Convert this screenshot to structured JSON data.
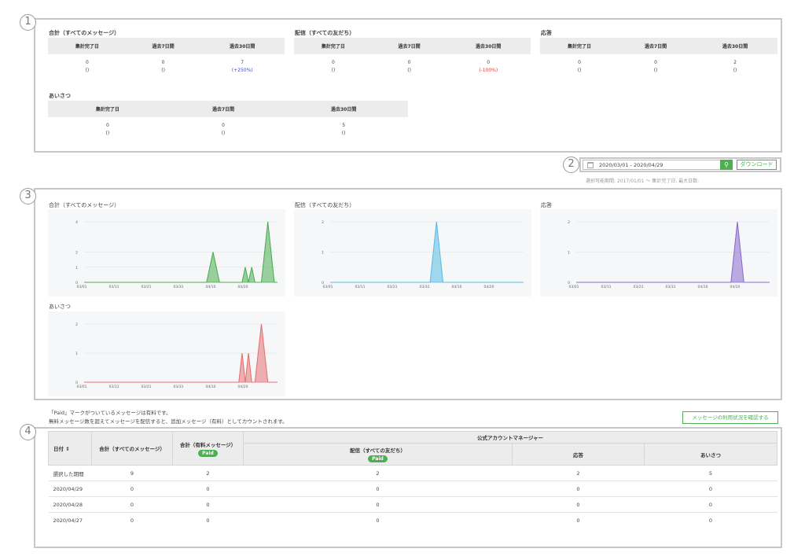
{
  "markers": {
    "m1": "1",
    "m2": "2",
    "m3": "3",
    "m4": "4"
  },
  "summary": {
    "headers": [
      "集計完了日",
      "過去7日間",
      "過去30日間"
    ],
    "blocks": [
      {
        "title": "合計（すべてのメッセージ）",
        "values": [
          "0",
          "0",
          "7"
        ],
        "changes": [
          "()",
          "()",
          "(+250%)"
        ]
      },
      {
        "title": "配信（すべての友だち）",
        "values": [
          "0",
          "0",
          "0"
        ],
        "changes": [
          "()",
          "()",
          "(-100%)"
        ]
      },
      {
        "title": "応答",
        "values": [
          "0",
          "0",
          "2"
        ],
        "changes": [
          "()",
          "()",
          "()"
        ]
      },
      {
        "title": "あいさつ",
        "values": [
          "0",
          "0",
          "5"
        ],
        "changes": [
          "()",
          "()",
          "()"
        ]
      }
    ]
  },
  "date_filter": {
    "range": "2020/03/01 - 2020/04/29",
    "download_label": "ダウンロード",
    "note": "選択可能期間: 2017/01/01 〜 集計完了日, 最大日数:"
  },
  "colors": {
    "green": "#4caf50",
    "blue": "#5bbde4",
    "purple": "#8b6ccf",
    "red": "#e57373"
  },
  "chart_data": [
    {
      "type": "area",
      "title": "合計（すべてのメッセージ）",
      "x": [
        "03/01",
        "03/11",
        "03/21",
        "03/31",
        "04/10",
        "04/20"
      ],
      "ylim": [
        0,
        4
      ],
      "yticks": [
        0,
        1,
        2,
        4
      ],
      "color": "#4caf50",
      "points": [
        [
          0,
          0
        ],
        [
          38,
          0
        ],
        [
          40,
          2
        ],
        [
          42,
          0
        ],
        [
          49,
          0
        ],
        [
          50,
          1
        ],
        [
          51,
          0
        ],
        [
          52,
          1
        ],
        [
          53,
          0
        ],
        [
          55,
          0
        ],
        [
          57,
          4
        ],
        [
          59,
          0
        ],
        [
          60,
          0
        ]
      ]
    },
    {
      "type": "area",
      "title": "配信（すべての友だち）",
      "x": [
        "03/01",
        "03/11",
        "03/21",
        "03/31",
        "04/10",
        "04/20"
      ],
      "ylim": [
        0,
        2
      ],
      "yticks": [
        0,
        1,
        2
      ],
      "color": "#5bbde4",
      "points": [
        [
          0,
          0
        ],
        [
          31,
          0
        ],
        [
          33,
          2
        ],
        [
          35,
          0
        ],
        [
          60,
          0
        ]
      ]
    },
    {
      "type": "area",
      "title": "応答",
      "x": [
        "03/01",
        "03/11",
        "03/21",
        "03/31",
        "04/10",
        "04/20"
      ],
      "ylim": [
        0,
        2
      ],
      "yticks": [
        0,
        1,
        2
      ],
      "color": "#8b6ccf",
      "points": [
        [
          0,
          0
        ],
        [
          48,
          0
        ],
        [
          50,
          2
        ],
        [
          52,
          0
        ],
        [
          60,
          0
        ]
      ]
    },
    {
      "type": "area",
      "title": "あいさつ",
      "x": [
        "03/01",
        "03/11",
        "03/21",
        "03/31",
        "04/10",
        "04/20"
      ],
      "ylim": [
        0,
        2
      ],
      "yticks": [
        0,
        1,
        2
      ],
      "color": "#e57373",
      "points": [
        [
          0,
          0
        ],
        [
          48,
          0
        ],
        [
          49,
          1
        ],
        [
          50,
          0
        ],
        [
          51,
          1
        ],
        [
          52,
          0
        ],
        [
          53,
          0
        ],
        [
          55,
          2
        ],
        [
          57,
          0
        ],
        [
          60,
          0
        ]
      ]
    }
  ],
  "info": {
    "line1": "「Paid」マークがついているメッセージは有料です。",
    "line2": "無料メッセージ数を超えてメッセージを配信すると、追加メッセージ（有料）としてカウントされます。",
    "usage_button": "メッセージの利用状況を確認する"
  },
  "table": {
    "h_date": "日付 ⇕",
    "h_total": "合計（すべてのメッセージ）",
    "h_paid_total": "合計（有料メッセージ）",
    "paid": "Paid",
    "h_group": "公式アカウントマネージャー",
    "h_broadcast": "配信（すべての友だち）",
    "h_reply": "応答",
    "h_greeting": "あいさつ",
    "rows": [
      [
        "選択した期間",
        "9",
        "2",
        "2",
        "2",
        "5"
      ],
      [
        "2020/04/29",
        "0",
        "0",
        "0",
        "0",
        "0"
      ],
      [
        "2020/04/28",
        "0",
        "0",
        "0",
        "0",
        "0"
      ],
      [
        "2020/04/27",
        "0",
        "0",
        "0",
        "0",
        "0"
      ]
    ]
  }
}
